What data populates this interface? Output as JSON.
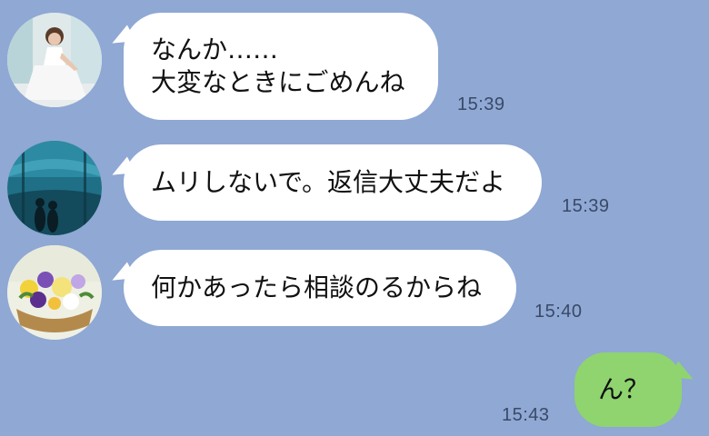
{
  "messages": [
    {
      "side": "incoming",
      "avatar_icon": "bride-avatar-icon",
      "text": "なんか……\n大変なときにごめんね",
      "time": "15:39"
    },
    {
      "side": "incoming",
      "avatar_icon": "aquarium-avatar-icon",
      "text": "ムリしないで。返信大丈夫だよ",
      "time": "15:39"
    },
    {
      "side": "incoming",
      "avatar_icon": "flowers-avatar-icon",
      "text": "何かあったら相談のるからね",
      "time": "15:40"
    },
    {
      "side": "outgoing",
      "text": "ん？",
      "time": "15:43"
    }
  ],
  "colors": {
    "background": "#8fa8d4",
    "incoming_bubble": "#ffffff",
    "outgoing_bubble": "#8fd46f",
    "timestamp": "#3a4a66"
  }
}
